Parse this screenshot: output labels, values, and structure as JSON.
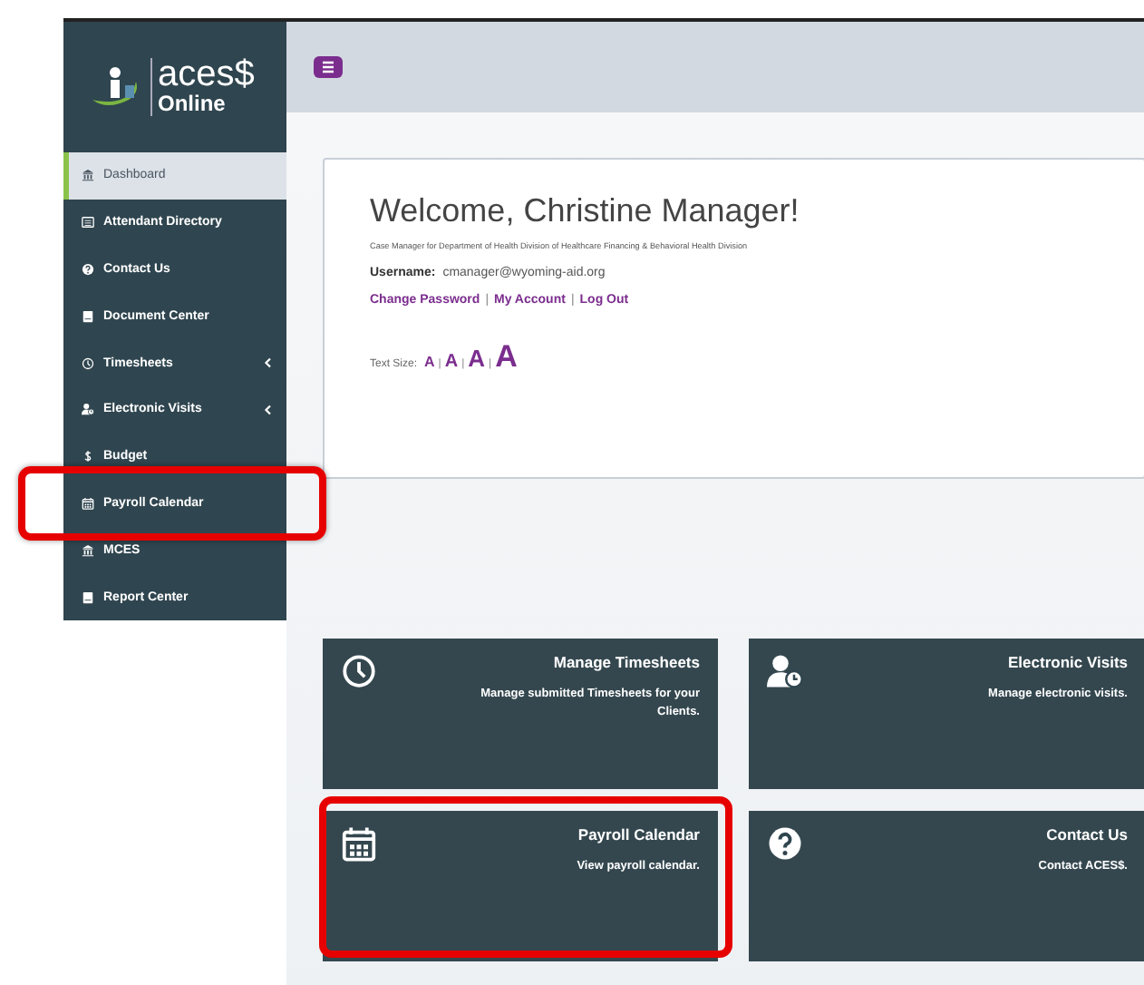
{
  "logo": {
    "name": "aces$",
    "subtitle": "Online"
  },
  "sidebar": {
    "items": [
      {
        "label": "Dashboard",
        "kind": "bank",
        "selected": true,
        "has_submenu": false,
        "highlighted": false
      },
      {
        "label": "Attendant Directory",
        "kind": "list",
        "selected": false,
        "has_submenu": false,
        "highlighted": false
      },
      {
        "label": "Contact Us",
        "kind": "question",
        "selected": false,
        "has_submenu": false,
        "highlighted": false
      },
      {
        "label": "Document Center",
        "kind": "book",
        "selected": false,
        "has_submenu": false,
        "highlighted": false
      },
      {
        "label": "Timesheets",
        "kind": "clock",
        "selected": false,
        "has_submenu": true,
        "highlighted": false
      },
      {
        "label": "Electronic Visits",
        "kind": "user-clock",
        "selected": false,
        "has_submenu": true,
        "highlighted": false
      },
      {
        "label": "Budget",
        "kind": "dollar",
        "selected": false,
        "has_submenu": false,
        "highlighted": false
      },
      {
        "label": "Payroll Calendar",
        "kind": "calendar",
        "selected": false,
        "has_submenu": false,
        "highlighted": true
      },
      {
        "label": "MCES",
        "kind": "bank",
        "selected": false,
        "has_submenu": false,
        "highlighted": false
      },
      {
        "label": "Report Center",
        "kind": "book",
        "selected": false,
        "has_submenu": false,
        "highlighted": false
      }
    ]
  },
  "welcome": {
    "title": "Welcome, Christine Manager!",
    "role": "Case Manager for Department of Health Division of Healthcare Financing & Behavioral Health Division",
    "username_label": "Username:",
    "username": "cmanager@wyoming-aid.org",
    "separator": "|",
    "links": [
      "Change Password",
      "My Account",
      "Log Out"
    ],
    "text_size_label": "Text Size:",
    "text_sizes": [
      "A",
      "A",
      "A",
      "A"
    ]
  },
  "tiles": [
    {
      "title": "Manage Timesheets",
      "description": "Manage submitted Timesheets for your Clients.",
      "kind": "clock",
      "highlighted": false
    },
    {
      "title": "Electronic Visits",
      "description": "Manage electronic visits.",
      "kind": "user-clock",
      "highlighted": false
    },
    {
      "title": "Payroll Calendar",
      "description": "View payroll calendar.",
      "kind": "calendar",
      "highlighted": true
    },
    {
      "title": "Contact Us",
      "description": "Contact ACES$.",
      "kind": "question",
      "highlighted": false
    }
  ]
}
